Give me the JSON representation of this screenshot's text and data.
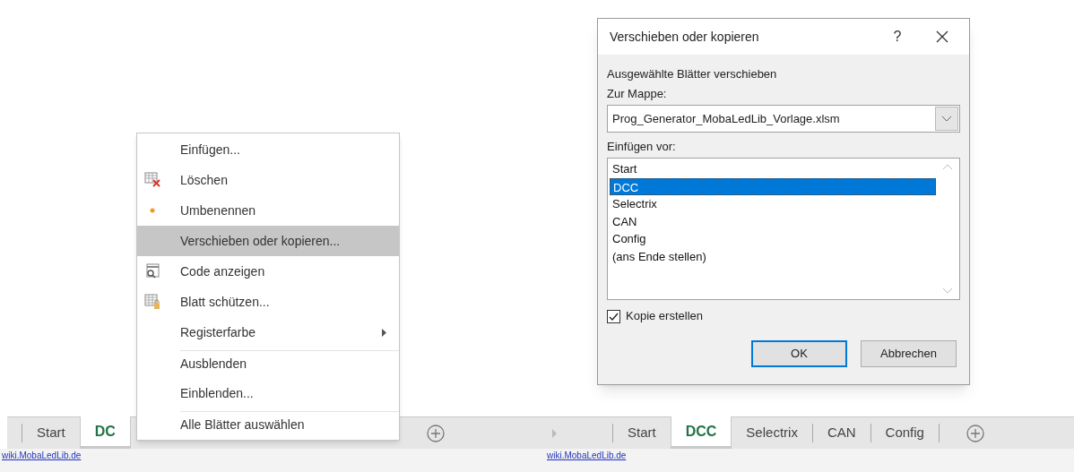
{
  "left_panel": {
    "sheet_tabs": [
      {
        "label": "Start",
        "selected": false
      },
      {
        "label": "DC",
        "selected": true
      }
    ],
    "context_menu": [
      {
        "label": "Einfügen...",
        "kind": "plain",
        "submenu": false,
        "selected": false,
        "separator_before": false
      },
      {
        "label": "Löschen",
        "kind": "delete",
        "submenu": false,
        "selected": false,
        "separator_before": false
      },
      {
        "label": "Umbenennen",
        "kind": "rename",
        "submenu": false,
        "selected": false,
        "separator_before": false
      },
      {
        "label": "Verschieben oder kopieren...",
        "kind": "plain",
        "submenu": false,
        "selected": true,
        "separator_before": false
      },
      {
        "label": "Code anzeigen",
        "kind": "code",
        "submenu": false,
        "selected": false,
        "separator_before": false
      },
      {
        "label": "Blatt schützen...",
        "kind": "protect",
        "submenu": false,
        "selected": false,
        "separator_before": false
      },
      {
        "label": "Registerfarbe",
        "kind": "plain",
        "submenu": true,
        "selected": false,
        "separator_before": false
      },
      {
        "label": "Ausblenden",
        "kind": "plain",
        "submenu": false,
        "selected": false,
        "separator_before": true
      },
      {
        "label": "Einblenden...",
        "kind": "plain",
        "submenu": false,
        "selected": false,
        "separator_before": false
      },
      {
        "label": "Alle Blätter auswählen",
        "kind": "plain",
        "submenu": false,
        "selected": false,
        "separator_before": true
      }
    ],
    "status_link": "wiki.MobaLedLib.de"
  },
  "right_panel": {
    "dialog": {
      "title": "Verschieben oder kopieren",
      "help": "?",
      "heading": "Ausgewählte Blätter verschieben",
      "workbook_label": "Zur Mappe:",
      "workbook_value": "Prog_Generator_MobaLedLib_Vorlage.xlsm",
      "insert_before_label": "Einfügen vor:",
      "sheets": [
        {
          "label": "Start",
          "selected": false
        },
        {
          "label": "DCC",
          "selected": true
        },
        {
          "label": "Selectrix",
          "selected": false
        },
        {
          "label": "CAN",
          "selected": false
        },
        {
          "label": "Config",
          "selected": false
        },
        {
          "label": "(ans Ende stellen)",
          "selected": false
        }
      ],
      "copy_checkbox": {
        "label": "Kopie erstellen",
        "checked": true
      },
      "buttons": [
        {
          "label": "OK",
          "default": true
        },
        {
          "label": "Abbrechen",
          "default": false
        }
      ]
    },
    "sheet_tabs": [
      {
        "label": "Start",
        "selected": false
      },
      {
        "label": "DCC",
        "selected": true
      },
      {
        "label": "Selectrix",
        "selected": false
      },
      {
        "label": "CAN",
        "selected": false
      },
      {
        "label": "Config",
        "selected": false
      }
    ],
    "status_link": "wiki.MobaLedLib.de"
  }
}
